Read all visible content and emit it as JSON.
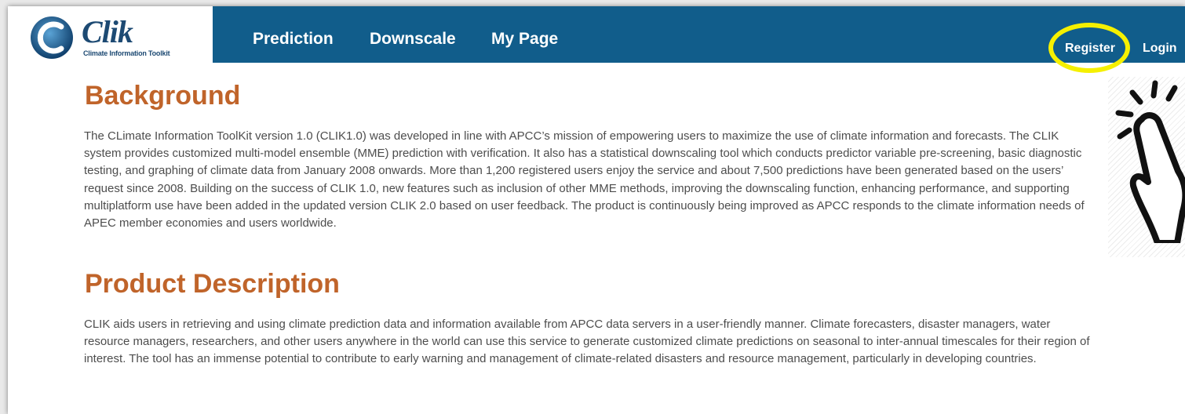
{
  "logo": {
    "wordmark": "Clik",
    "tagline": "Climate Information Toolkit"
  },
  "nav": {
    "items": [
      "Prediction",
      "Downscale",
      "My Page"
    ],
    "register_label": "Register",
    "login_label": "Login"
  },
  "sections": [
    {
      "title": "Background",
      "text": "The CLimate Information ToolKit version 1.0 (CLIK1.0) was developed in line with APCC’s mission of empowering users to maximize the use of climate information and forecasts. The CLIK system provides customized multi-model ensemble (MME) prediction with verification. It also has a statistical downscaling tool which conducts predictor variable pre-screening, basic diagnostic testing, and graphing of climate data from January 2008 onwards. More than 1,200 registered users enjoy the service and about 7,500 predictions have been generated based on the users’ request since 2008. Building on the success of CLIK 1.0, new features such as inclusion of other MME methods, improving the downscaling function, enhancing performance, and supporting multiplatform use have been added in the updated version CLIK 2.0 based on user feedback. The product is continuously being improved as APCC responds to the climate information needs of APEC member economies and users worldwide."
    },
    {
      "title": "Product Description",
      "text": "CLIK aids users in retrieving and using climate prediction data and information available from APCC data servers in a user-friendly manner. Climate forecasters, disaster managers, water resource managers, researchers, and other users anywhere in the world can use this service to generate customized climate predictions on seasonal to inter-annual timescales for their region of interest. The tool has an immense potential to contribute to early warning and management of climate-related disasters and resource management, particularly in developing countries."
    }
  ],
  "colors": {
    "navbar": "#115d8b",
    "heading": "#c0642a",
    "highlight": "#f5f000",
    "body_text": "#4d4d4d"
  },
  "overlay": {
    "highlight_target": "Register",
    "pointer_icon": "pointing-hand-icon"
  }
}
